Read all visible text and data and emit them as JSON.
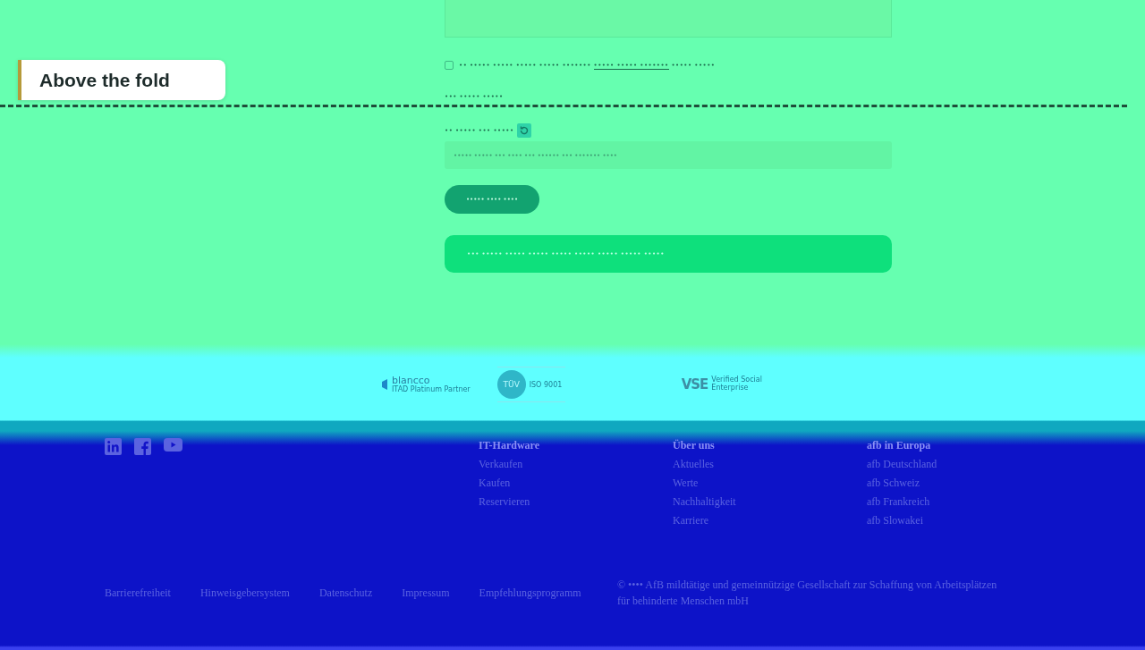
{
  "fold_marker": {
    "label": "Above the fold"
  },
  "form": {
    "consent": {
      "checked": false,
      "text_before": "•• ••••• ••••• ••••• ••••• •••••••",
      "link": "••••• ••••• •••••••",
      "text_after": "••••• •••••"
    },
    "note": "••• ••••• •••••",
    "captcha": {
      "label": "•• ••••• ••• •••••",
      "placeholder": "••••• ••••• ••• •••• ••• •••••• ••• ••••••• ••••"
    },
    "submit": "••••• •••• ••••",
    "message": "••• ••••• ••••• ••••• ••••• ••••• ••••• ••••• •••••"
  },
  "partners": [
    {
      "kind": "blancco",
      "name": "blancco",
      "caption": "ITAD Platinum Partner"
    },
    {
      "kind": "tuv",
      "name": "TÜV",
      "caption": "ISO 9001"
    },
    {
      "kind": "vse",
      "name": "VSE",
      "caption": "Verified Social Enterprise"
    }
  ],
  "footer": {
    "social": [
      {
        "kind": "linkedin"
      },
      {
        "kind": "facebook"
      },
      {
        "kind": "youtube"
      }
    ],
    "columns": [
      {
        "heading": "IT-Hardware",
        "links": [
          "Verkaufen",
          "Kaufen",
          "Reservieren"
        ]
      },
      {
        "heading": "Über uns",
        "links": [
          "Aktuelles",
          "Werte",
          "Nachhaltigkeit",
          "Karriere"
        ]
      },
      {
        "heading": "afb in Europa",
        "links": [
          "afb Deutschland",
          "afb Schweiz",
          "afb Frankreich",
          "afb Slowakei"
        ]
      }
    ],
    "legal_links": [
      "Barrierefreiheit",
      "Hinweisgebersystem",
      "Datenschutz",
      "Impressum",
      "Empfehlungsprogramm"
    ],
    "copyright": [
      "© •••• AfB mildtätige und gemeinnützige Gesellschaft zur Schaffung von Arbeitsplätzen",
      "für behinderte Menschen mbH"
    ]
  }
}
